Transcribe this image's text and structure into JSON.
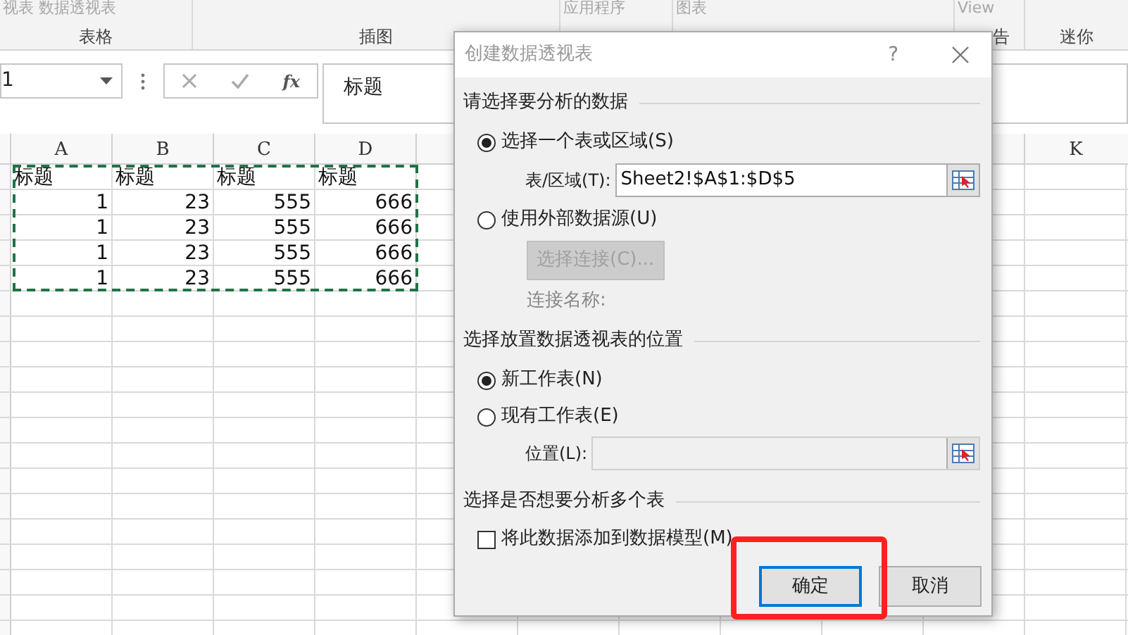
{
  "ribbon": {
    "groups": [
      {
        "top_text": "视表 数据透视表",
        "label": "表格"
      },
      {
        "label": "插图"
      },
      {
        "top_text": "应用程序"
      },
      {
        "top_text": "图表"
      },
      {
        "top_text": "View",
        "label": "告"
      },
      {
        "label": "迷你"
      }
    ]
  },
  "formula_bar": {
    "name_box": "1",
    "function_symbol": "fx",
    "formula": "标题"
  },
  "sheet": {
    "columns": [
      "A",
      "B",
      "C",
      "D",
      "K"
    ],
    "rows": [
      {
        "kind": "text",
        "cells": [
          "标题",
          "标题",
          "标题",
          "标题"
        ]
      },
      {
        "kind": "number",
        "cells": [
          "1",
          "23",
          "555",
          "666"
        ]
      },
      {
        "kind": "number",
        "cells": [
          "1",
          "23",
          "555",
          "666"
        ]
      },
      {
        "kind": "number",
        "cells": [
          "1",
          "23",
          "555",
          "666"
        ]
      },
      {
        "kind": "number",
        "cells": [
          "1",
          "23",
          "555",
          "666"
        ]
      }
    ]
  },
  "dialog": {
    "title": "创建数据透视表",
    "help": "?",
    "data_section": {
      "heading": "请选择要分析的数据",
      "options": [
        {
          "label": "选择一个表或区域(S)",
          "selected": true
        },
        {
          "label": "使用外部数据源(U)",
          "selected": false
        }
      ],
      "range_field": {
        "label": "表/区域(T):",
        "value": "Sheet2!$A$1:$D$5"
      },
      "connection_button": {
        "label": "选择连接(C)...",
        "disabled": true
      },
      "connection_name_label": "连接名称:"
    },
    "location_section": {
      "heading": "选择放置数据透视表的位置",
      "options": [
        {
          "label": "新工作表(N)",
          "selected": true
        },
        {
          "label": "现有工作表(E)",
          "selected": false
        }
      ],
      "location_field": {
        "label": "位置(L):",
        "disabled": true
      }
    },
    "model_section": {
      "heading": "选择是否想要分析多个表",
      "checkbox": {
        "label": "将此数据添加到数据模型(M)",
        "checked": false
      }
    },
    "buttons": [
      {
        "label": "确定",
        "focused": true
      },
      {
        "label": "取消",
        "focused": false
      }
    ]
  }
}
